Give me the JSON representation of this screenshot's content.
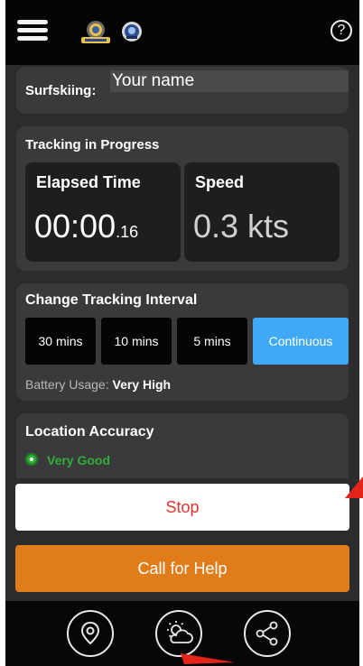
{
  "header": {
    "menu_icon": "hamburger-menu-icon",
    "logo_left": "coast-guard-logo",
    "logo_right": "agency-seal-logo",
    "help_icon": "help-circle-icon",
    "help_glyph": "?"
  },
  "profile": {
    "activity_label": "Surfskiing:",
    "name_placeholder": "Your name"
  },
  "tracking": {
    "title": "Tracking in Progress",
    "elapsed": {
      "label": "Elapsed Time",
      "value": "00:00",
      "fraction": ".16"
    },
    "speed": {
      "label": "Speed",
      "value": "0.3 kts"
    }
  },
  "interval": {
    "title": "Change Tracking Interval",
    "options": [
      "30 mins",
      "10 mins",
      "5 mins",
      "Continuous"
    ],
    "selected": "Continuous",
    "battery_label": "Battery Usage:",
    "battery_value": "Very High"
  },
  "location": {
    "title": "Location Accuracy",
    "value": "Very Good",
    "status_color": "#2fae3a"
  },
  "actions": {
    "stop_label": "Stop",
    "help_label": "Call for Help"
  },
  "bottom_nav": {
    "items": [
      "location-pin-icon",
      "weather-icon",
      "share-icon"
    ]
  },
  "colors": {
    "accent": "#3fa9f5",
    "stop_text": "#e5322d",
    "help_button": "#e07c1a"
  }
}
